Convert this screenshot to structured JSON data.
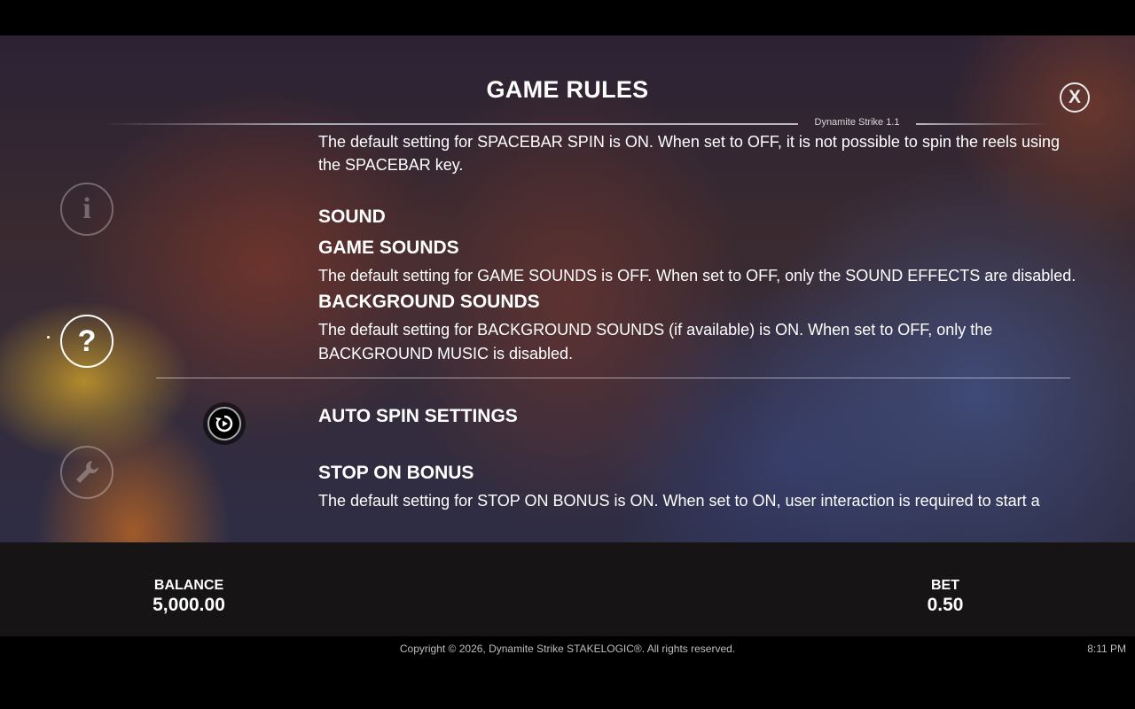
{
  "header": {
    "title": "GAME RULES",
    "version": "Dynamite Strike 1.1",
    "close_label": "X"
  },
  "sidebar": {
    "items": [
      {
        "name": "info",
        "glyph": "i",
        "active": false
      },
      {
        "name": "help",
        "glyph": "?",
        "active": true
      },
      {
        "name": "settings",
        "icon": "wrench-icon",
        "active": false
      }
    ]
  },
  "content": {
    "spacebar_text_line1": "The default setting for SPACEBAR SPIN is ON. When set to OFF, it is not possible to spin the reels using",
    "spacebar_text_line2": "the SPACEBAR key.",
    "sound_heading": "SOUND",
    "game_sounds_heading": "GAME SOUNDS",
    "game_sounds_text": "The default setting for GAME SOUNDS is OFF. When set to OFF, only the SOUND EFFECTS are disabled.",
    "background_sounds_heading": "BACKGROUND SOUNDS",
    "background_sounds_text_line1": "The default setting for BACKGROUND SOUNDS (if available) is ON. When set to OFF, only the",
    "background_sounds_text_line2": "BACKGROUND MUSIC is disabled.",
    "auto_spin_heading": "AUTO SPIN SETTINGS",
    "auto_spin_icon": "autoplay-icon",
    "stop_on_bonus_heading": "STOP ON BONUS",
    "stop_on_bonus_text": "The default setting for STOP ON BONUS is ON. When set to ON, user interaction is required to start a"
  },
  "bottom_bar": {
    "balance_label": "BALANCE",
    "balance_value": "5,000.00",
    "bet_label": "BET",
    "bet_value": "0.50"
  },
  "footer": {
    "copyright": "Copyright © 2026, Dynamite Strike STAKELOGIC®. All rights reserved.",
    "time": "8:11 PM"
  }
}
